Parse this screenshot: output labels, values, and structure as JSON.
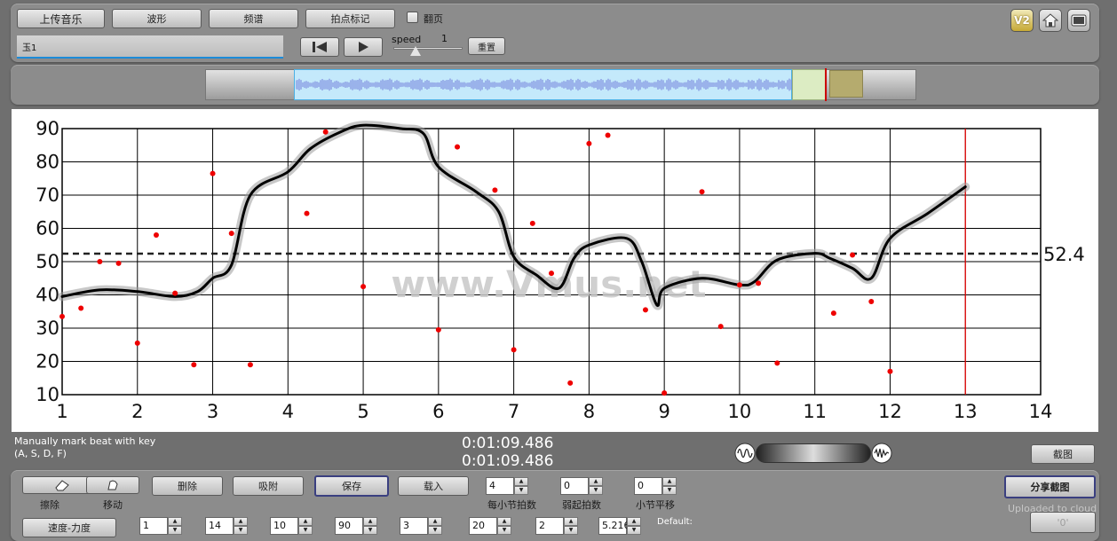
{
  "top_toolbar": {
    "upload_music": "上传音乐",
    "waveform": "波形",
    "spectrum": "频谱",
    "beat_marking": "拍点标记",
    "flip_page_label": "翻页",
    "song_name": "玉1",
    "speed_label": "speed",
    "speed_value": "1",
    "reset": "重置",
    "v2_badge": "V2"
  },
  "chart_data": {
    "type": "line",
    "x_ticks": [
      "1",
      "2",
      "3",
      "4",
      "5",
      "6",
      "7",
      "8",
      "9",
      "10",
      "11",
      "12",
      "13",
      "14"
    ],
    "y_ticks": [
      "10",
      "20",
      "30",
      "40",
      "50",
      "60",
      "70",
      "80",
      "90"
    ],
    "xlim": [
      1,
      14
    ],
    "ylim": [
      10,
      90
    ],
    "grid": true,
    "reference_line": {
      "value": 52.4,
      "label": "52.4",
      "style": "dashed"
    },
    "playhead_x": 13,
    "watermark": "www.Vmus.net",
    "series": [
      {
        "style": "smooth-black",
        "x": [
          1,
          1.5,
          2,
          2.5,
          2.8,
          3,
          3.25,
          3.5,
          4,
          4.3,
          4.7,
          5,
          5.5,
          5.8,
          6,
          6.5,
          6.8,
          7,
          7.3,
          7.6,
          7.8,
          8,
          8.5,
          8.7,
          8.9,
          9,
          9.5,
          10,
          10.2,
          10.5,
          11,
          11.2,
          11.5,
          11.75,
          12,
          12.5,
          13
        ],
        "y": [
          39.5,
          41.5,
          41,
          39.5,
          41,
          45,
          49,
          70,
          77,
          84,
          89,
          91,
          90,
          88.5,
          78.5,
          71,
          65,
          51.5,
          46,
          42,
          51,
          55,
          57,
          50,
          37,
          42,
          45,
          43,
          44,
          50.5,
          52.5,
          51,
          48,
          45,
          57,
          64.5,
          72.5
        ]
      },
      {
        "style": "red-dots",
        "x": [
          1,
          1.25,
          1.5,
          1.75,
          2,
          2.25,
          2.5,
          2.75,
          3,
          3.25,
          3.5,
          4.25,
          4.5,
          5,
          6,
          6.25,
          6.75,
          7,
          7.25,
          7.5,
          7.75,
          8,
          8.25,
          8.75,
          9,
          9.5,
          9.75,
          10,
          10.25,
          10.5,
          11.25,
          11.5,
          11.75,
          12
        ],
        "y": [
          33.5,
          36,
          50,
          49.5,
          25.5,
          58,
          40.5,
          19,
          76.5,
          58.5,
          19,
          64.5,
          89,
          42.5,
          29.5,
          84.5,
          71.5,
          23.5,
          61.5,
          46.5,
          13.5,
          85.5,
          88,
          35.5,
          10.5,
          71,
          30.5,
          43,
          43.5,
          19.5,
          34.5,
          52,
          38,
          17
        ]
      }
    ]
  },
  "mid_bar": {
    "instruction_line1": "Manually mark beat with key",
    "instruction_line2": "(A, S, D, F)",
    "time1": "0:01:09.486",
    "time2": "0:01:09.486",
    "screenshot": "截图"
  },
  "bottom_toolbar": {
    "erase": "擦除",
    "move": "移动",
    "delete": "删除",
    "snap": "吸附",
    "save": "保存",
    "load": "载入",
    "beats_per_bar_value": "4",
    "beats_per_bar_label": "每小节拍数",
    "pickup_beats_value": "0",
    "pickup_beats_label": "弱起拍数",
    "bar_shift_value": "0",
    "bar_shift_label": "小节平移",
    "share_screenshot": "分享截图",
    "uploaded_to_cloud": "Uploaded to cloud",
    "speed_strength": "速度-力度",
    "row2_values": [
      "1",
      "14",
      "10",
      "90",
      "3",
      "20",
      "2",
      "5.2163"
    ],
    "default_label": "Default:",
    "partial_button": "'0'"
  }
}
